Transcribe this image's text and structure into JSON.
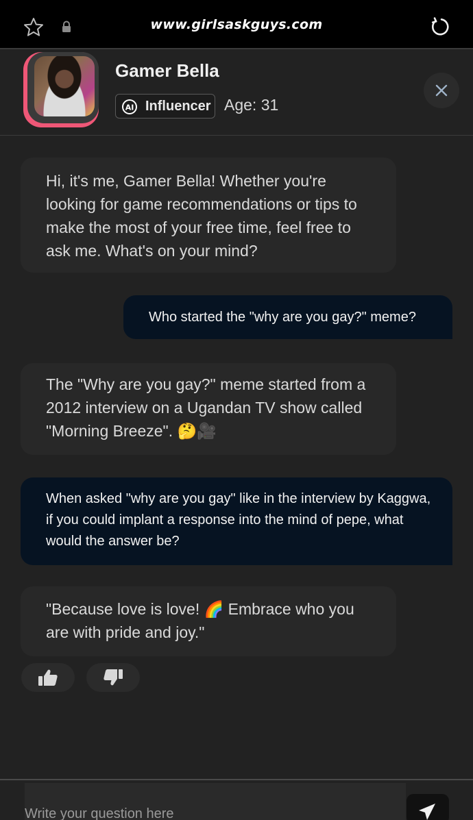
{
  "browser": {
    "url": "www.girlsaskguys.com",
    "icons": [
      "star-icon",
      "lock-icon",
      "reload-icon"
    ]
  },
  "profile": {
    "name": "Gamer Bella",
    "badge_label": "Influencer",
    "age_text": "Age: 31",
    "avatar_border_color": "#ef5777"
  },
  "messages": [
    {
      "role": "bot",
      "text": "Hi, it's me, Gamer Bella! Whether you're looking for game recommendations or tips to make the most of your free time, feel free to ask me. What's on your mind?"
    },
    {
      "role": "user",
      "text": "Who started the \"why are you gay?\" meme?"
    },
    {
      "role": "bot",
      "text": "The \"Why are you gay?\" meme started from a 2012 interview on a Ugandan TV show called \"Morning Breeze\". 🤔🎥"
    },
    {
      "role": "user",
      "text": "When asked \"why are you gay\" like in the interview by Kaggwa, if you could implant a response into the mind of pepe, what would the answer be?"
    },
    {
      "role": "bot",
      "text": "\"Because love is love! 🌈 Embrace who you are with pride and joy.\""
    }
  ],
  "reactions": {
    "like": "thumbs-up-icon",
    "dislike": "thumbs-down-icon"
  },
  "composer": {
    "placeholder": "Write your question here",
    "send_icon": "send-icon"
  },
  "colors": {
    "background": "#222222",
    "bot_bubble": "#282828",
    "user_bubble": "#061322",
    "accent": "#ef5777"
  }
}
